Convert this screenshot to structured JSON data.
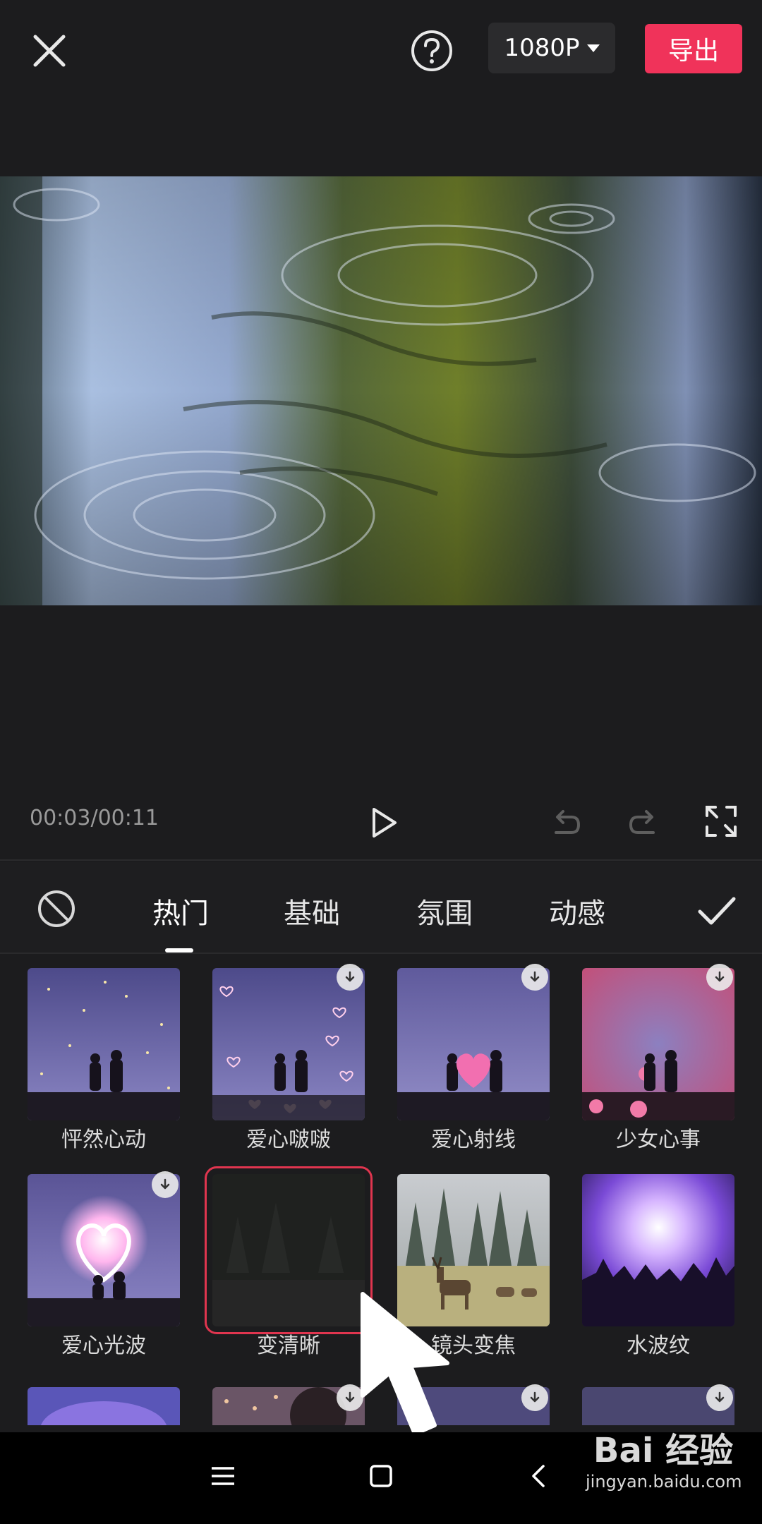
{
  "header": {
    "resolution": "1080P",
    "export_label": "导出"
  },
  "icons": {
    "close": "close-icon",
    "help": "help-icon",
    "resolution_dropdown": "caret-down-icon",
    "play": "play-icon",
    "undo": "undo-icon",
    "redo": "redo-icon",
    "fullscreen": "fullscreen-icon",
    "none_effect": "prohibit-icon",
    "confirm": "check-icon",
    "download": "download-icon"
  },
  "player": {
    "time": "00:03/00:11"
  },
  "tabs": [
    {
      "label": "热门",
      "active": true
    },
    {
      "label": "基础",
      "active": false
    },
    {
      "label": "氛围",
      "active": false
    },
    {
      "label": "动感",
      "active": false
    }
  ],
  "effects": [
    {
      "name": "怦然心动",
      "download": false,
      "selected": false,
      "thumb": "starry-couple"
    },
    {
      "name": "爱心啵啵",
      "download": true,
      "selected": false,
      "thumb": "hearts-couple"
    },
    {
      "name": "爱心射线",
      "download": true,
      "selected": false,
      "thumb": "heart-ray"
    },
    {
      "name": "少女心事",
      "download": true,
      "selected": false,
      "thumb": "pink-couple"
    },
    {
      "name": "爱心光波",
      "download": true,
      "selected": false,
      "thumb": "glow-heart"
    },
    {
      "name": "变清晰",
      "download": false,
      "selected": true,
      "thumb": "dark-blur"
    },
    {
      "name": "镜头变焦",
      "download": false,
      "selected": false,
      "thumb": "deer-forest"
    },
    {
      "name": "水波纹",
      "download": false,
      "selected": false,
      "thumb": "concert"
    }
  ],
  "more_row": [
    {
      "download": false
    },
    {
      "download": true
    },
    {
      "download": true
    },
    {
      "download": true
    }
  ],
  "colors": {
    "background": "#1c1c1e",
    "accent": "#f0335a",
    "selection": "#e0354f"
  },
  "watermark": {
    "logo": "Bai 经验",
    "url": "jingyan.baidu.com"
  }
}
